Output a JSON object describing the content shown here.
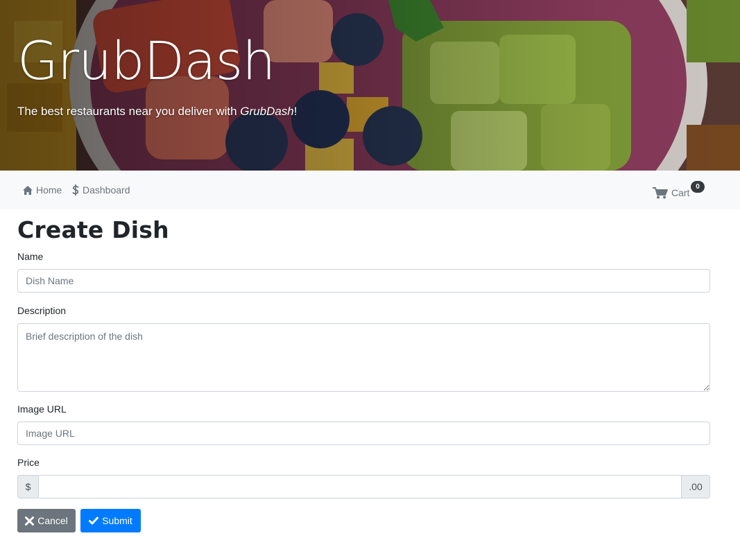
{
  "hero": {
    "title": "GrubDash",
    "tagline_prefix": "The best restaurants near you deliver with ",
    "tagline_brand": "GrubDash",
    "tagline_suffix": "!"
  },
  "nav": {
    "home_label": "Home",
    "home_icon": "home-icon",
    "dashboard_label": "Dashboard",
    "dashboard_icon": "dollar-icon",
    "cart_label": "Cart",
    "cart_icon": "cart-icon",
    "cart_count": "0"
  },
  "form": {
    "title": "Create Dish",
    "name": {
      "label": "Name",
      "placeholder": "Dish Name",
      "value": ""
    },
    "description": {
      "label": "Description",
      "placeholder": "Brief description of the dish",
      "value": ""
    },
    "image_url": {
      "label": "Image URL",
      "placeholder": "Image URL",
      "value": ""
    },
    "price": {
      "label": "Price",
      "prefix": "$",
      "suffix": ".00",
      "value": ""
    },
    "cancel_label": "Cancel",
    "cancel_icon": "x-icon",
    "submit_label": "Submit",
    "submit_icon": "check-icon"
  },
  "colors": {
    "primary": "#007bff",
    "secondary": "#6c757d",
    "navbar_bg": "#f8f9fa",
    "badge_bg": "#343a40"
  }
}
